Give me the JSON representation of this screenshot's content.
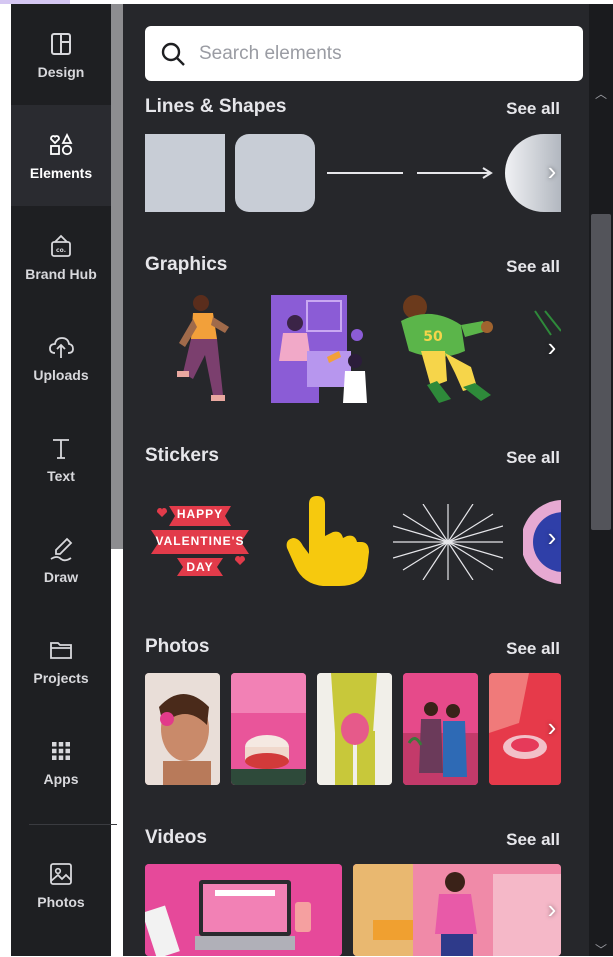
{
  "rail": {
    "items": [
      {
        "label": "Design",
        "icon": "layout-icon"
      },
      {
        "label": "Elements",
        "icon": "shapes-icon"
      },
      {
        "label": "Brand Hub",
        "icon": "brand-hub-icon"
      },
      {
        "label": "Uploads",
        "icon": "cloud-upload-icon"
      },
      {
        "label": "Text",
        "icon": "text-icon"
      },
      {
        "label": "Draw",
        "icon": "draw-icon"
      },
      {
        "label": "Projects",
        "icon": "folder-icon"
      },
      {
        "label": "Apps",
        "icon": "apps-grid-icon"
      },
      {
        "label": "Photos",
        "icon": "photos-icon"
      }
    ],
    "active": "Elements"
  },
  "search": {
    "placeholder": "Search elements"
  },
  "sections": [
    {
      "title": "Lines & Shapes",
      "see_all": "See all"
    },
    {
      "title": "Graphics",
      "see_all": "See all"
    },
    {
      "title": "Stickers",
      "see_all": "See all"
    },
    {
      "title": "Photos",
      "see_all": "See all"
    },
    {
      "title": "Videos",
      "see_all": "See all"
    }
  ],
  "stickers": {
    "valentine": {
      "line1": "HAPPY",
      "line2": "VALENTINE'S",
      "line3": "DAY"
    }
  },
  "colors": {
    "rail_bg": "#1e1f22",
    "panel_bg": "#26272b",
    "text": "#e6e6ea",
    "accent_purple": "#8b5cd6",
    "sticker_red": "#e23b4a",
    "sticker_yellow": "#f6c90e"
  }
}
